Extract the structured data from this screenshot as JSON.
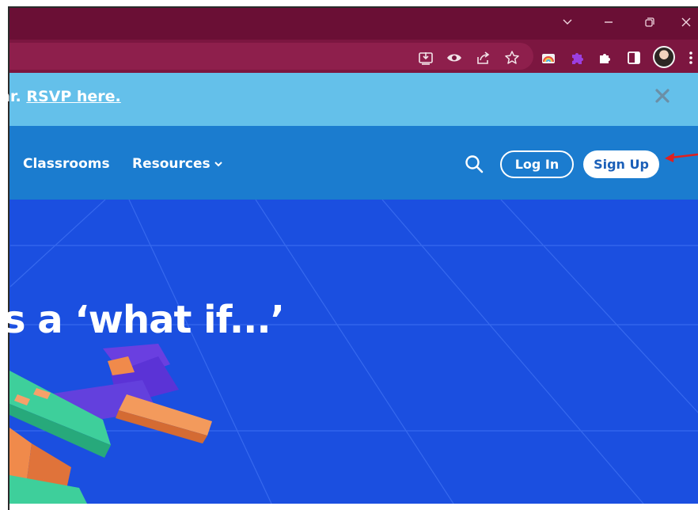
{
  "browser": {
    "titlebar_color": "#6a0f35",
    "toolbar_color": "#7c1640",
    "window_controls": [
      "chevron-down-icon",
      "minimize-icon",
      "restore-icon",
      "close-icon"
    ],
    "toolbar_icons": [
      "install-app-icon",
      "eye-icon",
      "share-icon",
      "bookmark-star-icon",
      "extension-rainbow-icon",
      "extension-puzzle-purple-icon",
      "extensions-icon",
      "side-panel-icon",
      "profile-avatar",
      "menu-kebab-icon"
    ]
  },
  "banner": {
    "prefix": "ar.",
    "link": "RSVP here.",
    "background": "#64c0ea",
    "close_icon": "close-icon"
  },
  "nav": {
    "items": [
      {
        "label": "Classrooms"
      },
      {
        "label": "Resources"
      }
    ],
    "search_icon": "search-icon",
    "login_label": "Log In",
    "signup_label": "Sign Up",
    "background": "#1b7ccf"
  },
  "hero": {
    "headline": "s a ‘what if...’",
    "background": "#1b4fe0"
  },
  "annotation": {
    "arrow_color": "#e0201e"
  }
}
